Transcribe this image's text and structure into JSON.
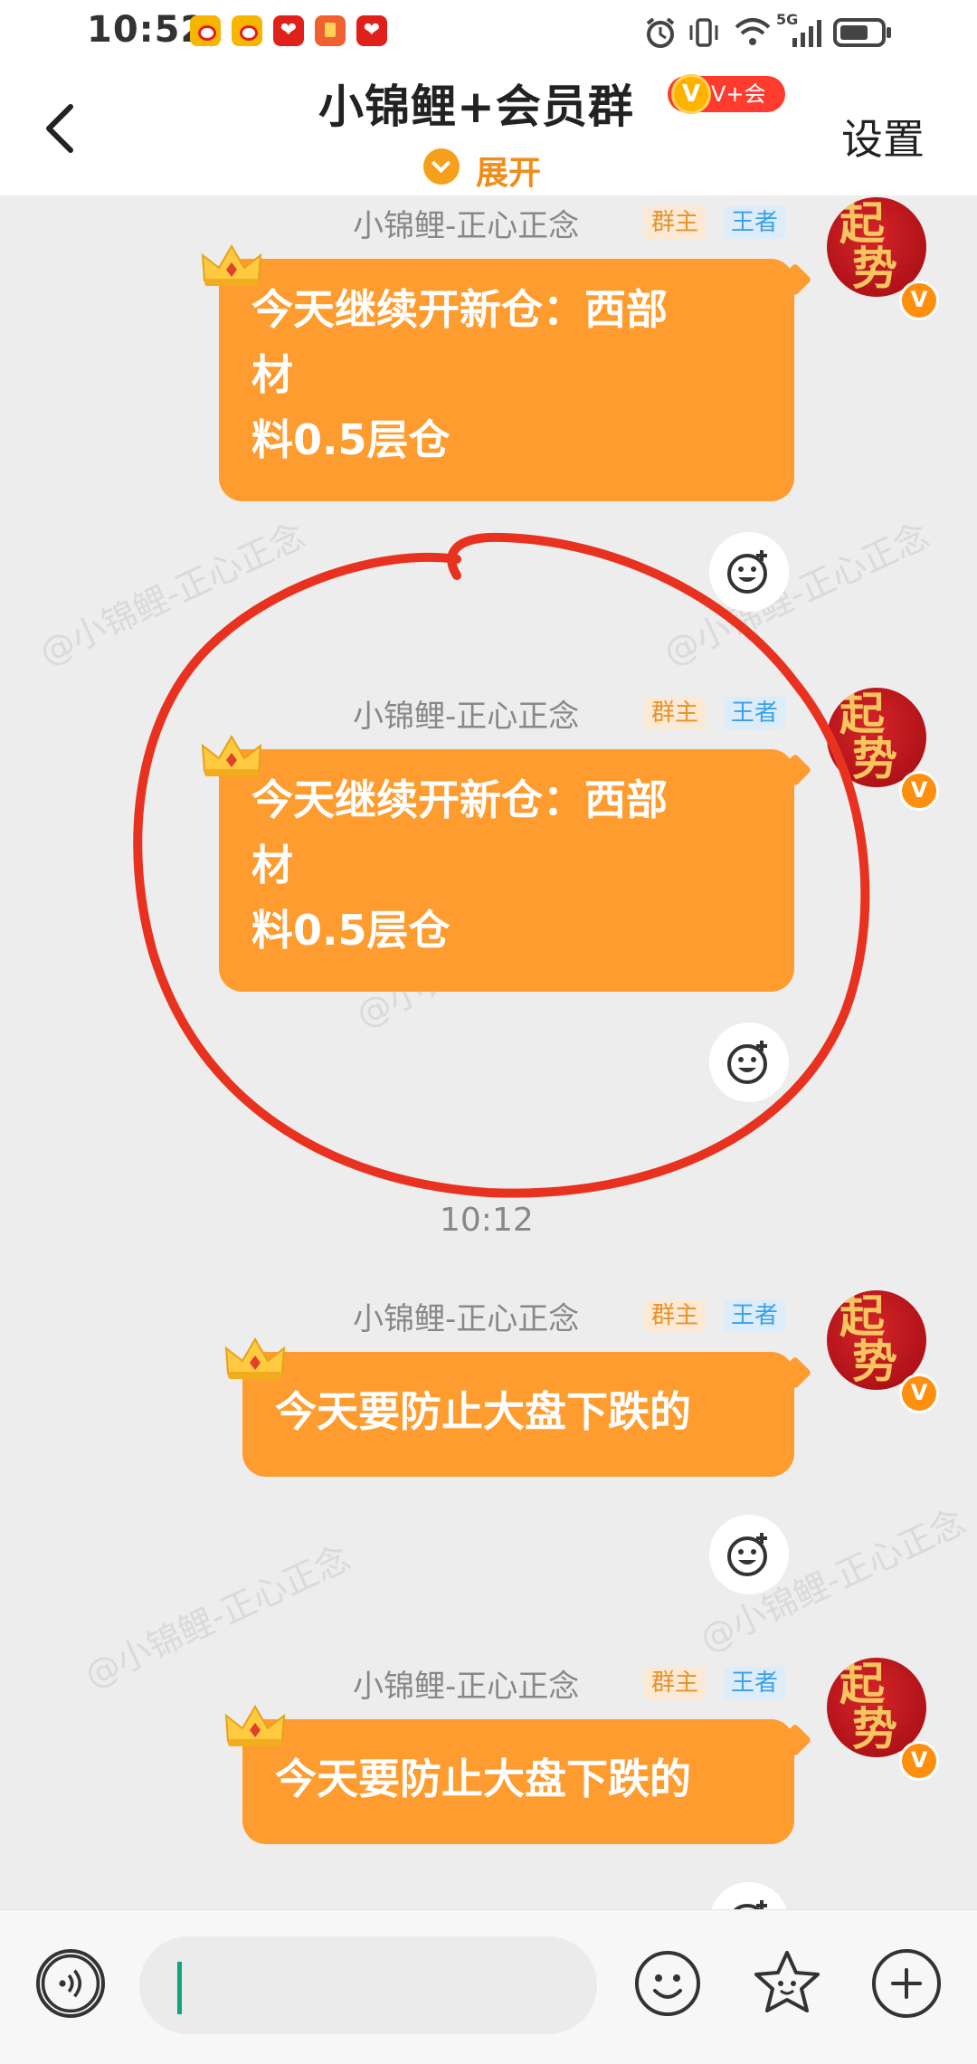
{
  "status_bar": {
    "time": "10:52",
    "network": "5G",
    "icons": [
      "weibo-icon",
      "weibo-icon",
      "red-app-icon",
      "red-envelope-icon",
      "red-app-icon"
    ]
  },
  "header": {
    "title": "小锦鲤+会员群",
    "vip_badge_v": "V",
    "vip_badge_text": "V+会员",
    "settings_label": "设置",
    "expand_label": "展开"
  },
  "messages": [
    {
      "sender": "小锦鲤-正心正念",
      "tag_owner": "群主",
      "tag_rank": "王者",
      "lines": [
        "今天继续开新仓：西部",
        "材",
        "料0.5层仓"
      ],
      "avatar_text": [
        "起",
        "势"
      ],
      "avatar_badge": "V"
    },
    {
      "sender": "小锦鲤-正心正念",
      "tag_owner": "群主",
      "tag_rank": "王者",
      "lines": [
        "今天继续开新仓：西部",
        "材",
        "料0.5层仓"
      ],
      "avatar_text": [
        "起",
        "势"
      ],
      "avatar_badge": "V"
    },
    {
      "sender": "小锦鲤-正心正念",
      "tag_owner": "群主",
      "tag_rank": "王者",
      "lines": [
        "今天要防止大盘下跌的"
      ],
      "avatar_text": [
        "起",
        "势"
      ],
      "avatar_badge": "V"
    },
    {
      "sender": "小锦鲤-正心正念",
      "tag_owner": "群主",
      "tag_rank": "王者",
      "lines": [
        "今天要防止大盘下跌的"
      ],
      "avatar_text": [
        "起",
        "势"
      ],
      "avatar_badge": "V"
    }
  ],
  "time_divider": "10:12",
  "watermark": "@小锦鲤-正心正念",
  "input": {
    "value": "",
    "placeholder": ""
  },
  "colors": {
    "bubble": "#fe9c2f",
    "accent": "#ef8c1a",
    "annotation_circle": "#e8321f"
  }
}
